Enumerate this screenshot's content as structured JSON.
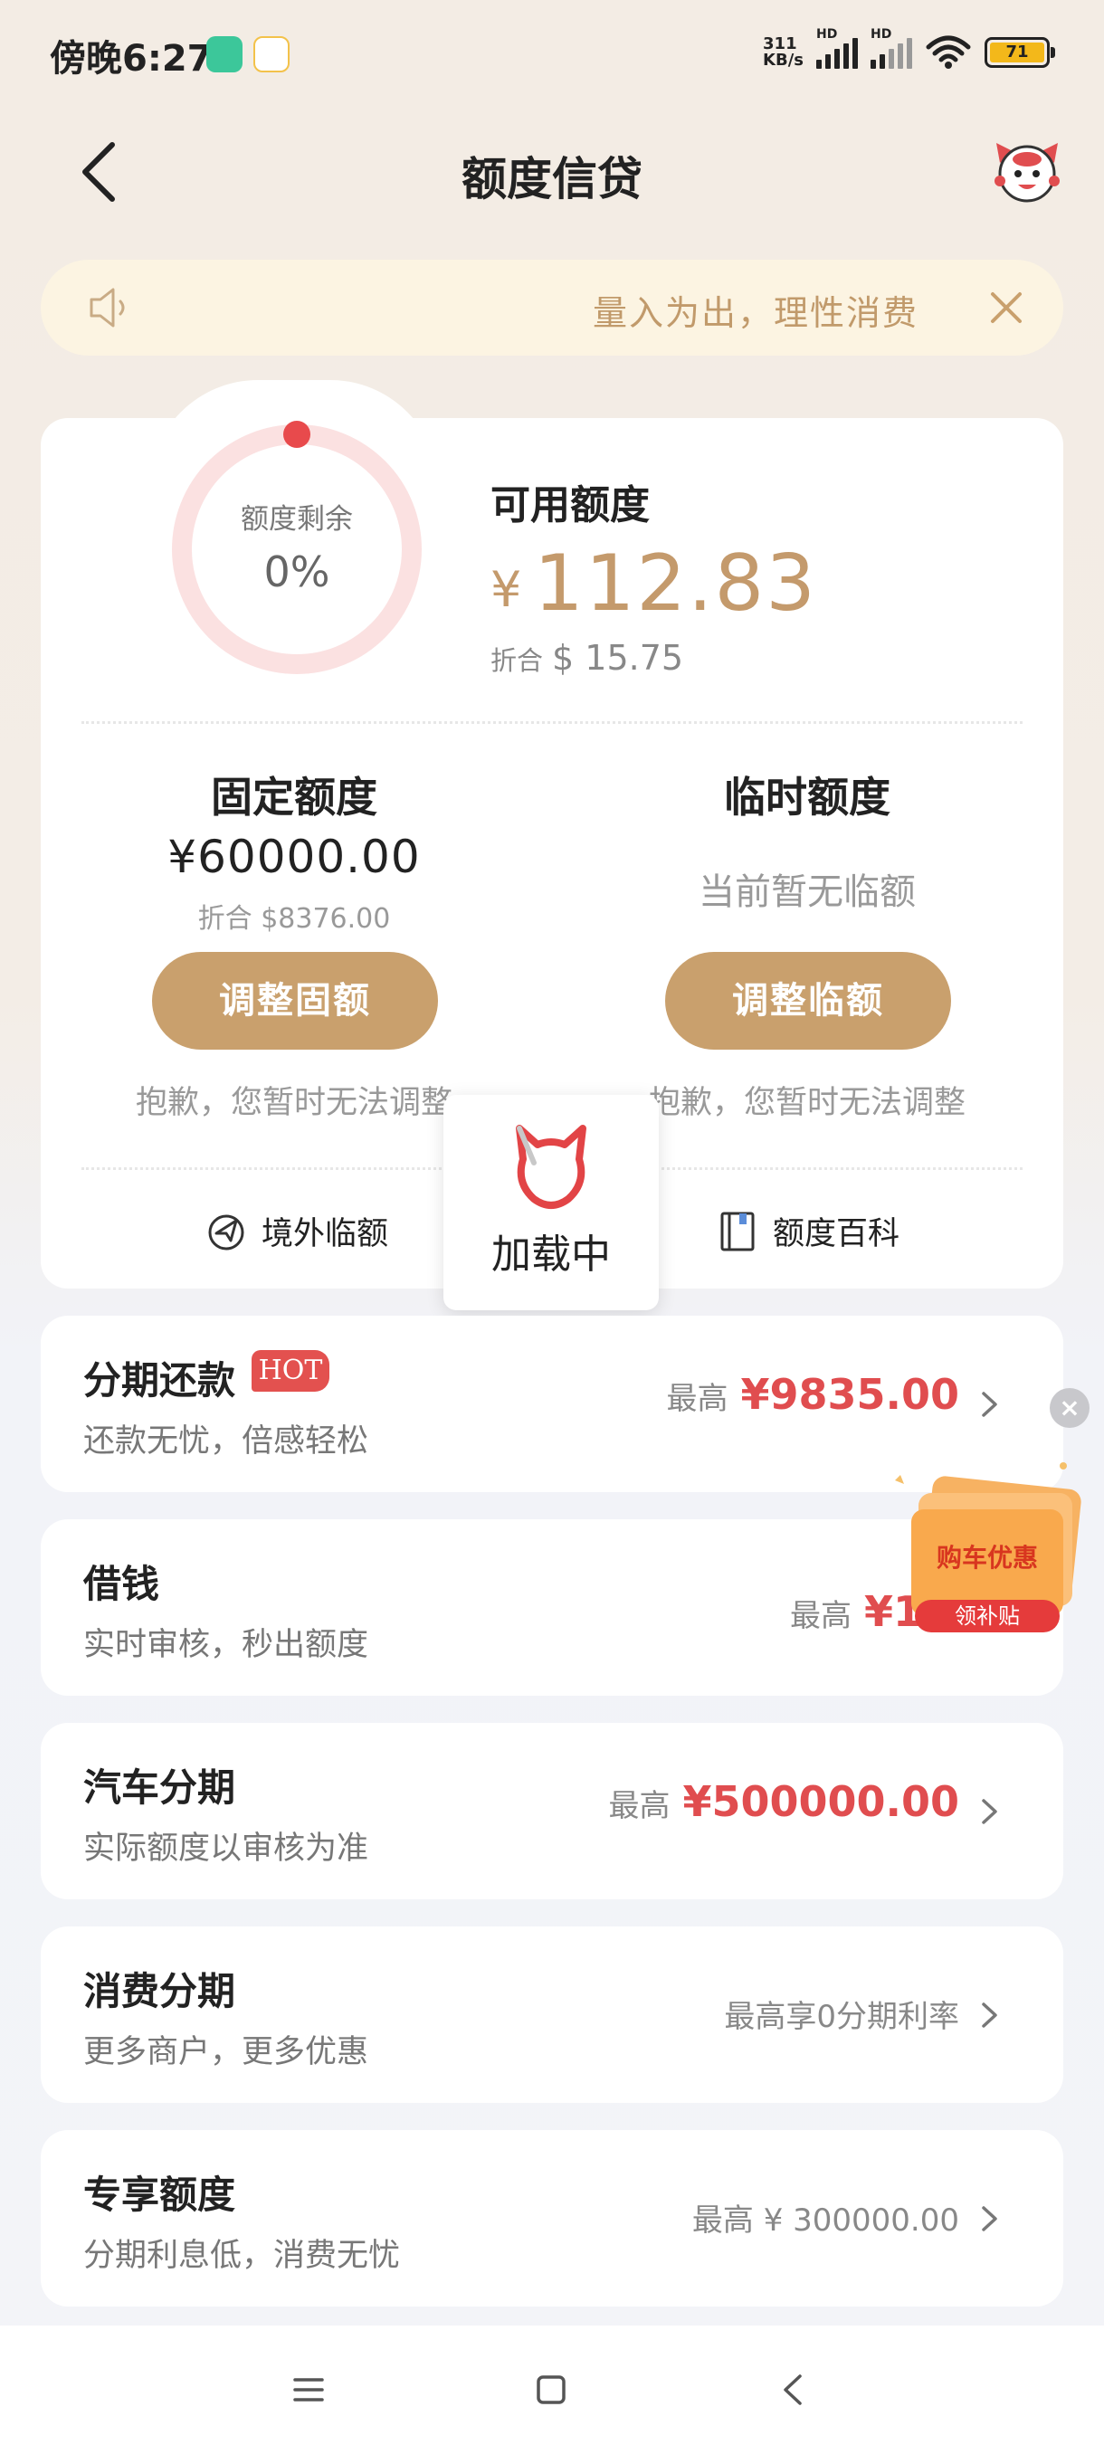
{
  "status_bar": {
    "time": "傍晚6:27",
    "net_speed_top": "311",
    "net_speed_bottom": "KB/s",
    "hd1": "HD",
    "hd2": "HD",
    "battery": "71"
  },
  "header": {
    "title": "额度信贷"
  },
  "notice": {
    "text": "量入为出，理性消费"
  },
  "quota": {
    "ring_label": "额度剩余",
    "ring_value": "0%",
    "ring_fraction": 0,
    "available_label": "可用额度",
    "currency": "¥",
    "available_amount": "112.83",
    "equiv_label": "折合",
    "equiv_amount": "$ 15.75"
  },
  "fixed": {
    "title": "固定额度",
    "amount": "¥60000.00",
    "equiv": "折合 $8376.00",
    "button": "调整固额",
    "note": "抱歉，您暂时无法调整"
  },
  "temp": {
    "title": "临时额度",
    "none_text": "当前暂无临额",
    "button": "调整临额",
    "note": "抱歉，您暂时无法调整"
  },
  "links": {
    "overseas": "境外临额",
    "wiki": "额度百科"
  },
  "loading": {
    "text": "加载中"
  },
  "products": [
    {
      "title": "分期还款",
      "badge": "HOT",
      "subtitle": "还款无忧，倍感轻松",
      "prefix": "最高",
      "amount": "¥9835.00"
    },
    {
      "title": "借钱",
      "subtitle": "实时审核，秒出额度",
      "prefix": "最高",
      "amount": "¥1"
    },
    {
      "title": "汽车分期",
      "subtitle": "实际额度以审核为准",
      "prefix": "最高",
      "amount": "¥500000.00"
    },
    {
      "title": "消费分期",
      "subtitle": "更多商户，更多优惠",
      "right_text": "最高享0分期利率"
    },
    {
      "title": "专享额度",
      "subtitle": "分期利息低，消费无忧",
      "right_text": "最高 ¥ 300000.00"
    }
  ],
  "promo": {
    "line1": "购车优惠",
    "line2": "领补贴"
  },
  "colors": {
    "accent_gold": "#c9a06d",
    "price_red": "#e04d4f",
    "notice_bg": "#fcf4e2"
  }
}
